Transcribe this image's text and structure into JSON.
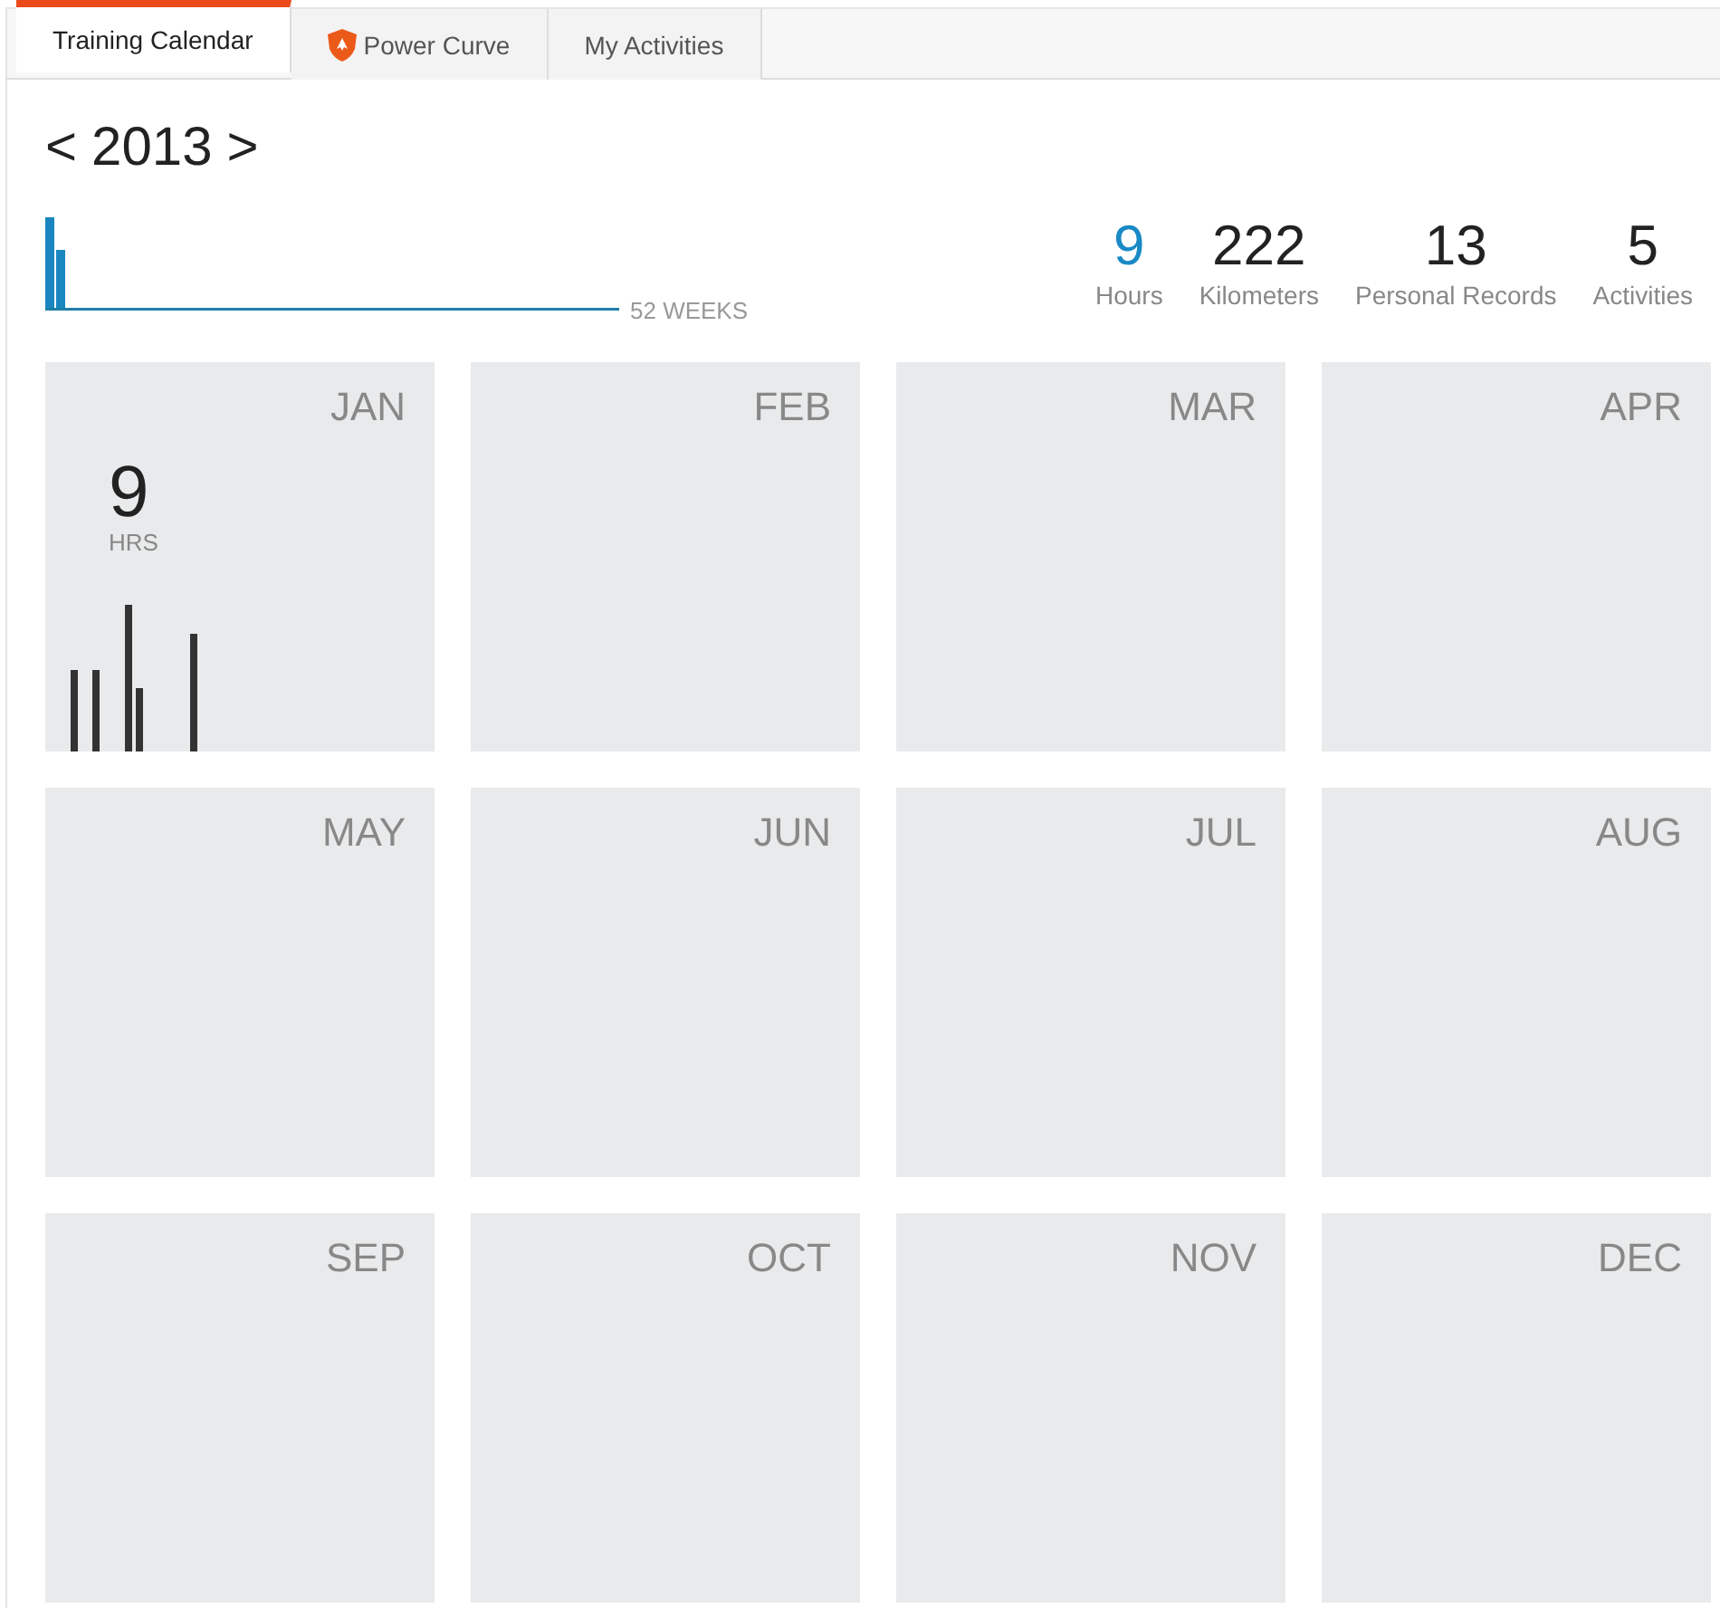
{
  "tabs": [
    {
      "label": "Training Calendar",
      "selected": true,
      "kind": "plain"
    },
    {
      "label": "Power Curve",
      "selected": false,
      "kind": "shield"
    },
    {
      "label": "My Activities",
      "selected": false,
      "kind": "plain"
    }
  ],
  "year": {
    "prev": "<",
    "label": "2013",
    "next": ">"
  },
  "week_chart": {
    "label": "52 WEEKS"
  },
  "stats": [
    {
      "value": "9",
      "label": "Hours",
      "selected": true
    },
    {
      "value": "222",
      "label": "Kilometers",
      "selected": false
    },
    {
      "value": "13",
      "label": "Personal Records",
      "selected": false
    },
    {
      "value": "5",
      "label": "Activities",
      "selected": false
    }
  ],
  "months": [
    {
      "name": "JAN",
      "hours": "9",
      "unit": "HRS"
    },
    {
      "name": "FEB"
    },
    {
      "name": "MAR"
    },
    {
      "name": "APR"
    },
    {
      "name": "MAY"
    },
    {
      "name": "JUN"
    },
    {
      "name": "JUL"
    },
    {
      "name": "AUG"
    },
    {
      "name": "SEP"
    },
    {
      "name": "OCT"
    },
    {
      "name": "NOV"
    },
    {
      "name": "DEC"
    }
  ]
}
